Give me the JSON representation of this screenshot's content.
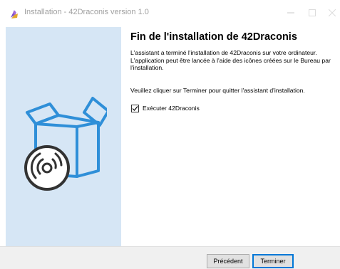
{
  "window": {
    "title": "Installation - 42Draconis version 1.0",
    "icon": "setup-app-icon",
    "controls": [
      "minimize-icon",
      "maximize-icon",
      "close-icon"
    ]
  },
  "side_panel": {
    "graphic": "software-box-with-disc-icon",
    "color": "#d6e6f5"
  },
  "main": {
    "heading": "Fin de l'installation de 42Draconis",
    "paragraph1": "L'assistant a terminé l'installation de 42Draconis sur votre ordinateur. L'application peut être lancée à l'aide des icônes créées sur le Bureau par l'installation.",
    "paragraph2": "Veuillez cliquer sur Terminer pour quitter l'assistant d'installation.",
    "checkbox": {
      "label": "Exécuter 42Draconis",
      "checked": true
    }
  },
  "footer": {
    "back_label": "Précédent",
    "finish_label": "Terminer"
  },
  "colors": {
    "accent": "#0078d7",
    "illustration": "#2f8fd8"
  }
}
